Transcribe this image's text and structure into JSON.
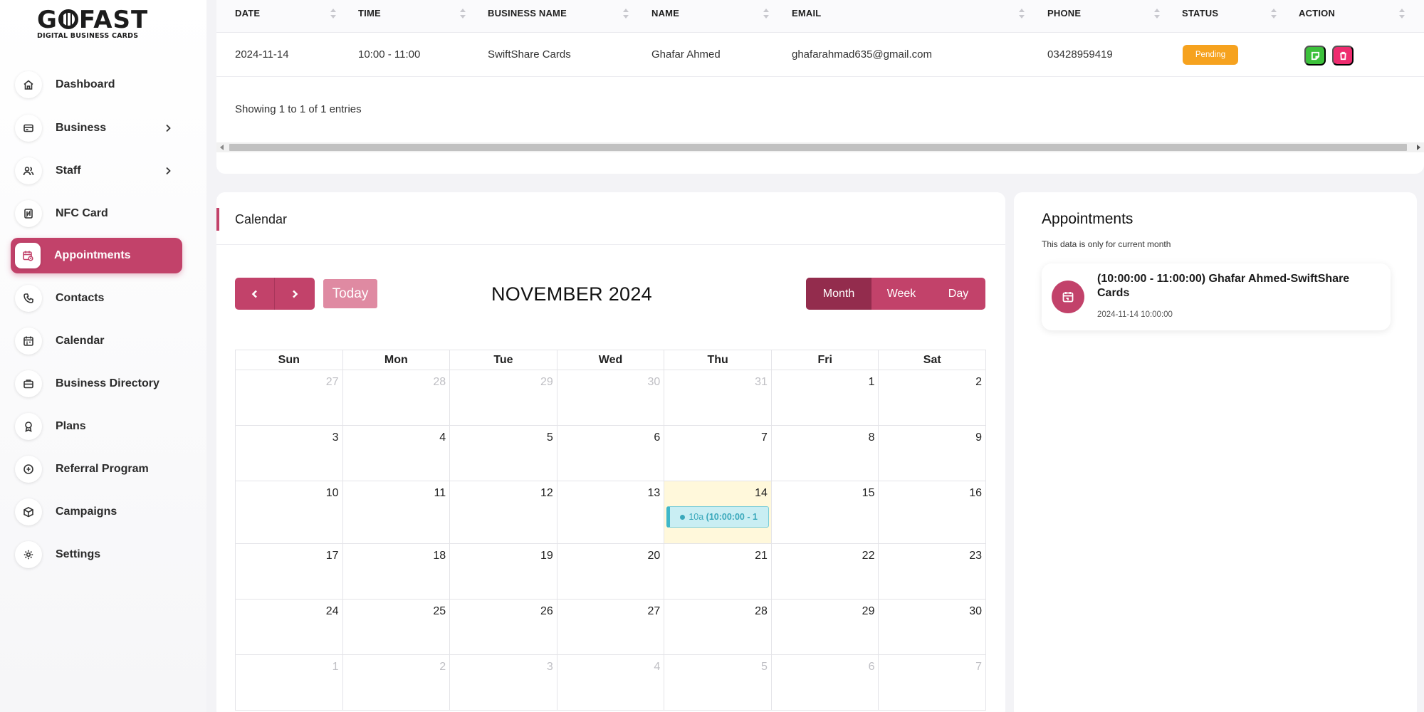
{
  "logo": {
    "main": "G  FAST",
    "sub": "DIGITAL BUSINESS CARDS"
  },
  "sidebar": {
    "items": [
      {
        "label": "Dashboard",
        "icon": "home-icon"
      },
      {
        "label": "Business",
        "icon": "card-icon",
        "chevron": true
      },
      {
        "label": "Staff",
        "icon": "users-icon",
        "chevron": true
      },
      {
        "label": "NFC Card",
        "icon": "nfc-icon"
      },
      {
        "label": "Appointments",
        "icon": "calendar-clock-icon",
        "active": true
      },
      {
        "label": "Contacts",
        "icon": "phone-icon"
      },
      {
        "label": "Calendar",
        "icon": "calendar-icon"
      },
      {
        "label": "Business Directory",
        "icon": "briefcase-icon"
      },
      {
        "label": "Plans",
        "icon": "award-icon"
      },
      {
        "label": "Referral Program",
        "icon": "gift-icon"
      },
      {
        "label": "Campaigns",
        "icon": "box-icon"
      },
      {
        "label": "Settings",
        "icon": "gear-icon"
      }
    ]
  },
  "table": {
    "headers": [
      "DATE",
      "TIME",
      "BUSINESS NAME",
      "NAME",
      "EMAIL",
      "PHONE",
      "STATUS",
      "ACTION"
    ],
    "rows": [
      {
        "date": "2024-11-14",
        "time": "10:00 - 11:00",
        "business": "SwiftShare Cards",
        "name": "Ghafar Ahmed",
        "email": "ghafarahmad635@gmail.com",
        "phone": "03428959419",
        "status": "Pending"
      }
    ],
    "entries_text": "Showing 1 to 1 of 1 entries"
  },
  "calendar": {
    "title": "Calendar",
    "today_label": "Today",
    "month_title": "NOVEMBER 2024",
    "views": [
      "Month",
      "Week",
      "Day"
    ],
    "day_headers": [
      "Sun",
      "Mon",
      "Tue",
      "Wed",
      "Thu",
      "Fri",
      "Sat"
    ],
    "weeks": [
      [
        "27",
        "28",
        "29",
        "30",
        "31",
        "1",
        "2"
      ],
      [
        "3",
        "4",
        "5",
        "6",
        "7",
        "8",
        "9"
      ],
      [
        "10",
        "11",
        "12",
        "13",
        "14",
        "15",
        "16"
      ],
      [
        "17",
        "18",
        "19",
        "20",
        "21",
        "22",
        "23"
      ],
      [
        "24",
        "25",
        "26",
        "27",
        "28",
        "29",
        "30"
      ],
      [
        "1",
        "2",
        "3",
        "4",
        "5",
        "6",
        "7"
      ]
    ],
    "event": {
      "time": "10a",
      "label": "(10:00:00 - 1"
    }
  },
  "appointments": {
    "title": "Appointments",
    "subtitle": "This data is only for current month",
    "items": [
      {
        "text": "(10:00:00 - 11:00:00) Ghafar Ahmed-SwiftShare Cards",
        "datetime": "2024-11-14 10:00:00"
      }
    ]
  },
  "colors": {
    "accent": "#c2426a",
    "accent_dark": "#932c4d",
    "pending": "#f6a21e",
    "edit": "#3cc13b",
    "delete": "#ee2c6f",
    "today_bg": "#fff8db",
    "event_bg": "#c9eef3"
  }
}
